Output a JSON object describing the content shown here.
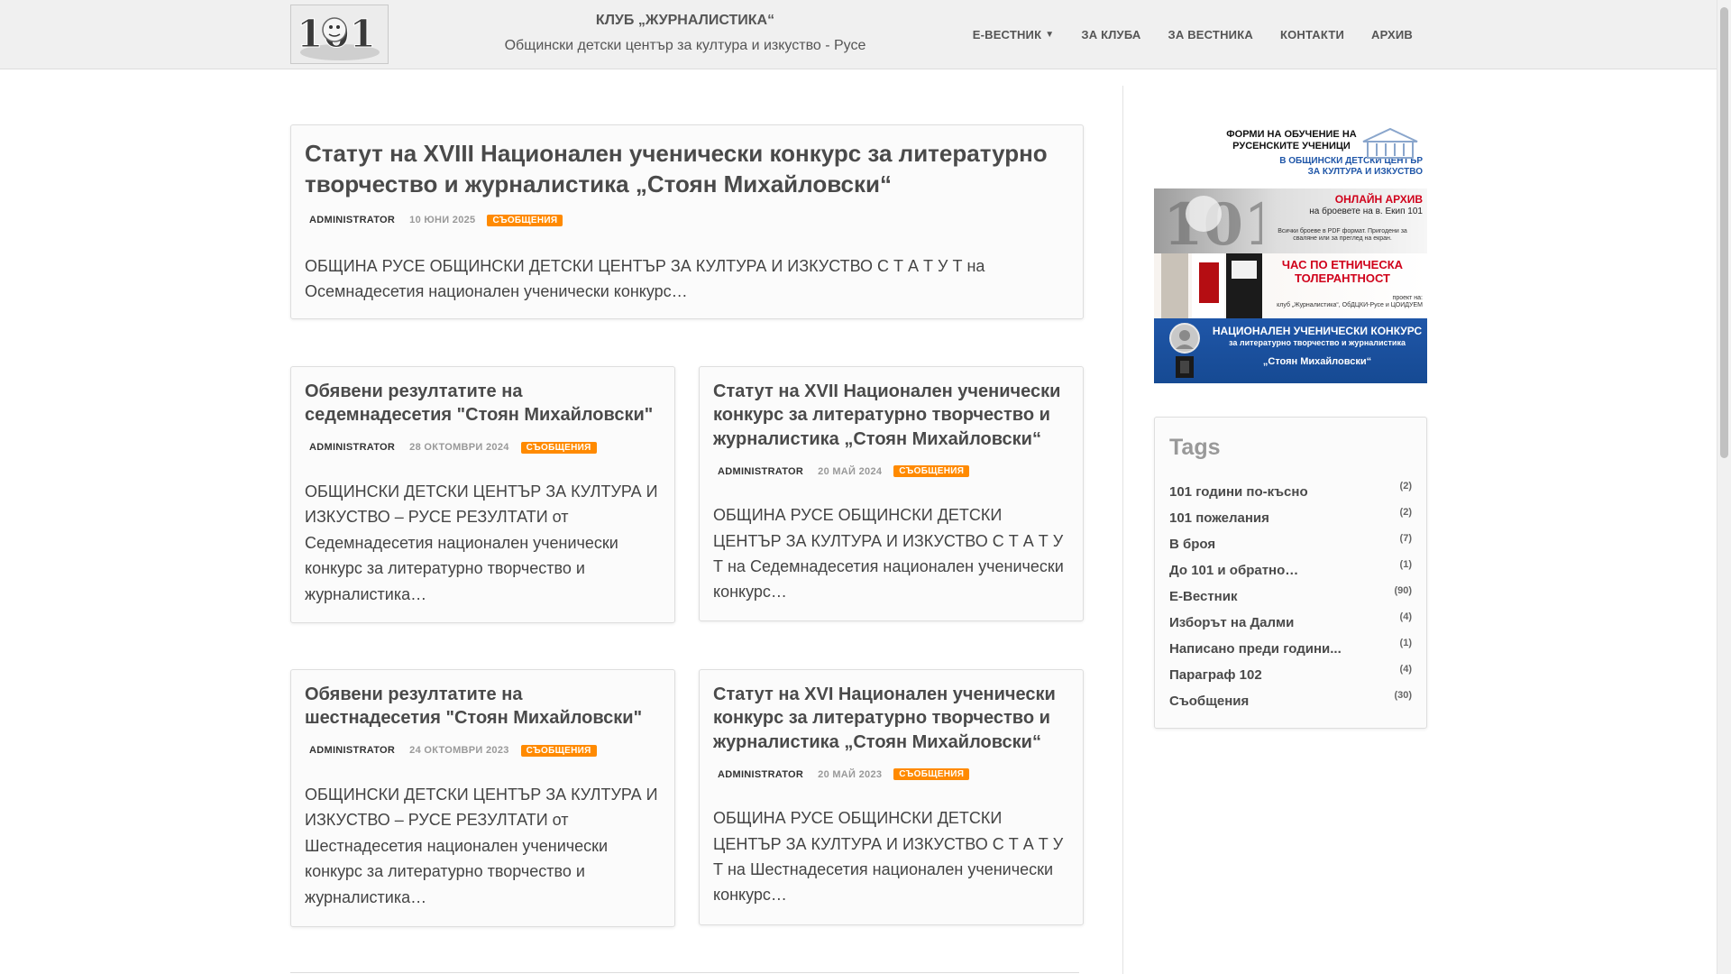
{
  "header": {
    "title": "КЛУБ „ЖУРНАЛИСТИКА“",
    "subtitle": "Общински детски център за култура и изкуство - Русе",
    "logo_text": "101",
    "nav": [
      {
        "label": "Е-ВЕСТНИК",
        "has_dropdown": true
      },
      {
        "label": "ЗА КЛУБА"
      },
      {
        "label": "ЗА ВЕСТНИКА"
      },
      {
        "label": "КОНТАКТИ"
      },
      {
        "label": "АРХИВ"
      }
    ]
  },
  "posts": [
    {
      "title": "Статут на XVIII Национален ученически конкурс за литературно творчество и журналистика „Стоян Михайловски“",
      "author": "ADMINISTRATOR",
      "date": "10 ЮНИ 2025",
      "category": "СЪОБЩЕНИЯ",
      "excerpt": "ОБЩИНА РУСЕ ОБЩИНСКИ ДЕТСКИ ЦЕНТЪР ЗА КУЛТУРА И ИЗКУСТВО С Т А Т У Т на Осемнадесетия национален ученически конкурс…"
    },
    {
      "title": "Обявени резултатите на седемнадесетия \"Стоян Михайловски\"",
      "author": "ADMINISTRATOR",
      "date": "28 ОКТОМВРИ 2024",
      "category": "СЪОБЩЕНИЯ",
      "excerpt": "ОБЩИНСКИ ДЕТСКИ ЦЕНТЪР ЗА КУЛТУРА И ИЗКУСТВО – РУСЕ РЕЗУЛТАТИ от Седемнадесетия национален ученически конкурс за литературно творчество и журналистика…"
    },
    {
      "title": "Статут на XVII Национален ученически конкурс за литературно творчество и журналистика „Стоян Михайловски“",
      "author": "ADMINISTRATOR",
      "date": "20 МАЙ 2024",
      "category": "СЪОБЩЕНИЯ",
      "excerpt": "ОБЩИНА РУСЕ ОБЩИНСКИ ДЕТСКИ ЦЕНТЪР ЗА КУЛТУРА И ИЗКУСТВО С Т А Т У Т на Седемнадесетия национален ученически конкурс…"
    },
    {
      "title": "Обявени резултатите на шестнадесетия \"Стоян Михайловски\"",
      "author": "ADMINISTRATOR",
      "date": "24 ОКТОМВРИ 2023",
      "category": "СЪОБЩЕНИЯ",
      "excerpt": "ОБЩИНСКИ ДЕТСКИ ЦЕНТЪР ЗА КУЛТУРА И ИЗКУСТВО – РУСЕ РЕЗУЛТАТИ от Шестнадесетия национален ученически конкурс за литературно творчество и журналистика…"
    },
    {
      "title": "Статут на XVI Национален ученически конкурс за литературно творчество и журналистика „Стоян Михайловски“",
      "author": "ADMINISTRATOR",
      "date": "20 МАЙ 2023",
      "category": "СЪОБЩЕНИЯ",
      "excerpt": "ОБЩИНА РУСЕ ОБЩИНСКИ ДЕТСКИ ЦЕНТЪР ЗА КУЛТУРА И ИЗКУСТВО С Т А Т У Т на Шестнадесетия национален ученически конкурс…"
    }
  ],
  "banners": [
    {
      "line1": "ФОРМИ НА ОБУЧЕНИЕ НА",
      "line2": "РУСЕНСКИТЕ УЧЕНИЦИ",
      "line3": "В ОБЩИНСКИ ДЕТСКИ ЦЕНТЪР",
      "line4": "ЗА КУЛТУРА И ИЗКУСТВО"
    },
    {
      "line1": "ОНЛАЙН АРХИВ",
      "line2": "на броевете на в. Екип 101",
      "line3": "Всички броеве в PDF формат. Пригодени за",
      "line4": "сваляне или за преглед на екран."
    },
    {
      "line1": "ЧАС ПО ЕТНИЧЕСКА",
      "line2": "ТОЛЕРАНТНОСТ",
      "line3": "проект на:",
      "line4": "клуб „Журналистика“, ОбДЦКИ-Русе и ЦОИДУЕМ"
    },
    {
      "line1": "НАЦИОНАЛЕН УЧЕНИЧЕСКИ КОНКУРС",
      "line2": "за литературно творчество и журналистика",
      "line3": "„Стоян Михайловски“"
    }
  ],
  "tags": {
    "title": "Tags",
    "items": [
      {
        "name": "101 години по-късно",
        "count": "(2)"
      },
      {
        "name": "101 пожелания",
        "count": "(2)"
      },
      {
        "name": "В броя",
        "count": "(7)"
      },
      {
        "name": "До 101 и обратно…",
        "count": "(1)"
      },
      {
        "name": "Е-Вестник",
        "count": "(90)"
      },
      {
        "name": "Изборът на Далми",
        "count": "(4)"
      },
      {
        "name": "Написано преди години...",
        "count": "(1)"
      },
      {
        "name": "Параграф 102",
        "count": "(4)"
      },
      {
        "name": "Съобщения",
        "count": "(30)"
      }
    ]
  },
  "colors": {
    "category_badge": "#ff8a00",
    "header_bg": "#f0f0f0",
    "banner_blue": "#1f56a8",
    "banner_red": "#d0021b"
  }
}
